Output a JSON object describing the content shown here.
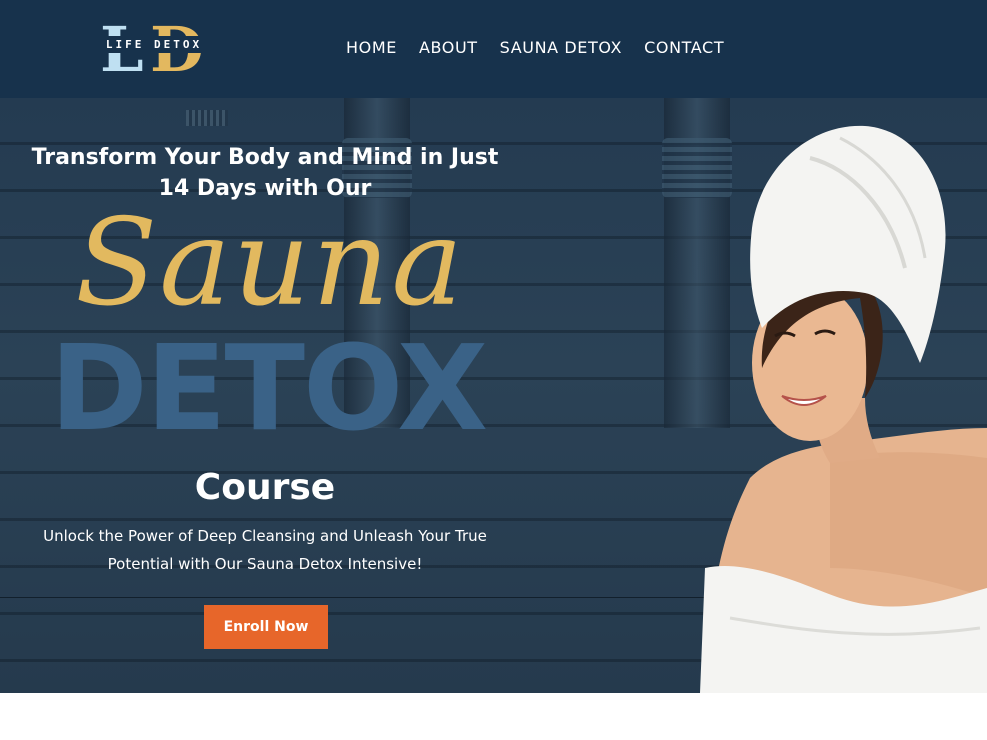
{
  "header": {
    "logo": {
      "text": "LIFE DETOX",
      "monogram_left": "L",
      "monogram_right": "D"
    },
    "nav": [
      "HOME",
      "ABOUT",
      "SAUNA DETOX",
      "CONTACT"
    ]
  },
  "hero": {
    "headline_line1": "Transform Your Body and Mind in Just",
    "headline_line2": "14 Days with Our",
    "script_word": "Sauna",
    "big_word": "DETOX",
    "course": "Course",
    "subtitle_line1": "Unlock the Power of Deep Cleansing and Unleash Your True",
    "subtitle_line2": "Potential with Our Sauna Detox Intensive!",
    "cta": "Enroll Now"
  },
  "colors": {
    "header_bg": "#17324c",
    "hero_bg": "#2b4256",
    "gold": "#e2b95f",
    "detox_blue": "#3a6287",
    "cta": "#e7662a"
  },
  "icons": [
    "logo-mark"
  ]
}
